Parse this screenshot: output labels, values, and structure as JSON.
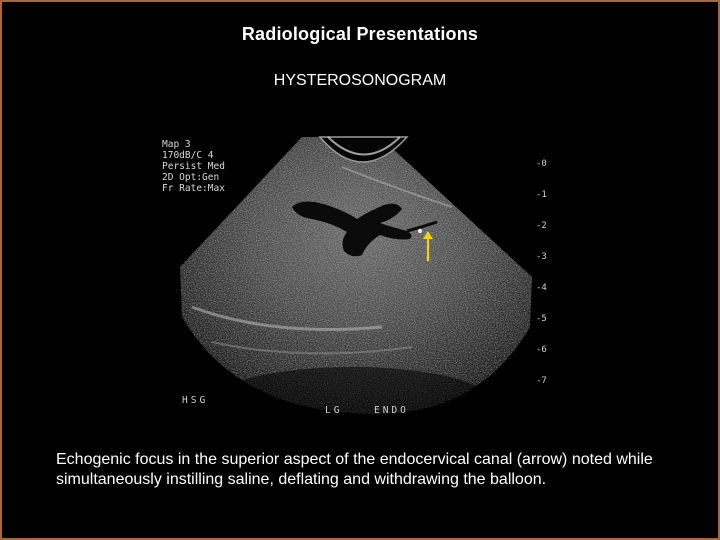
{
  "slide": {
    "title": "Radiological Presentations",
    "subtitle": "HYSTEROSONOGRAM",
    "caption": "Echogenic focus in the superior aspect of the endocervical canal (arrow) noted while simultaneously instilling saline, deflating and withdrawing the balloon."
  },
  "ultrasound": {
    "params": [
      "Map 3",
      "170dB/C 4",
      "Persist Med",
      "2D Opt:Gen",
      "Fr Rate:Max"
    ],
    "label_hsg": "HSG",
    "label_lg": "LG",
    "label_endo": "ENDO",
    "depth_scale": [
      "0",
      "1",
      "2",
      "3",
      "4",
      "5",
      "6",
      "7"
    ],
    "arrow_color": "#f2d21a"
  },
  "colors": {
    "border": "#a8683c",
    "background": "#000000",
    "text": "#ffffff"
  }
}
